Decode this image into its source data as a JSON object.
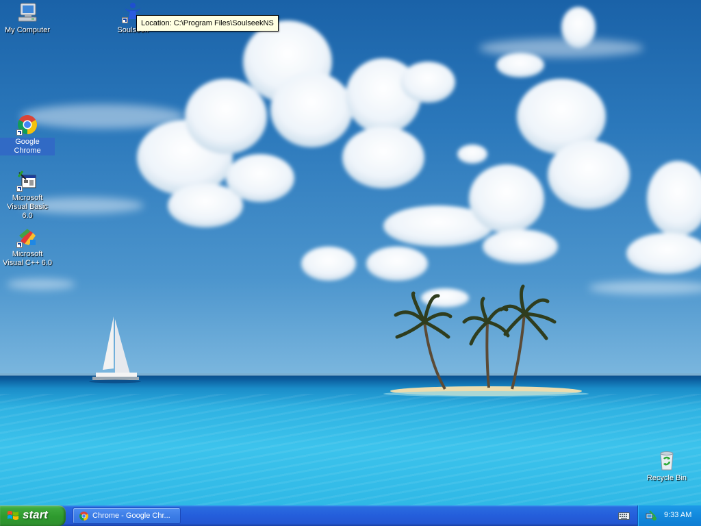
{
  "desktop": {
    "icons": [
      {
        "label": "My Computer",
        "icon": "my-computer-icon"
      },
      {
        "label": "Soulseek",
        "icon": "soulseek-icon"
      },
      {
        "label": "Google Chrome",
        "icon": "chrome-icon",
        "selected": true
      },
      {
        "label": "Microsoft Visual Basic 6.0",
        "icon": "visual-basic-icon"
      },
      {
        "label": "Microsoft Visual C++ 6.0",
        "icon": "visual-cpp-icon"
      },
      {
        "label": "Recycle Bin",
        "icon": "recycle-bin-icon"
      }
    ],
    "tooltip": "Location: C:\\Program Files\\SoulseekNS"
  },
  "taskbar": {
    "start_label": "start",
    "tasks": [
      {
        "label": "Chrome - Google Chr...",
        "icon": "chrome-icon"
      }
    ],
    "tray": {
      "clock": "9:33 AM",
      "icons": [
        "keyboard-icon",
        "network-icon"
      ]
    }
  },
  "colors": {
    "taskbar": "#245edb",
    "start_button": "#3da93d",
    "tray": "#0f8ad8",
    "selection": "#316ac5",
    "tooltip_bg": "#ffffe1"
  }
}
